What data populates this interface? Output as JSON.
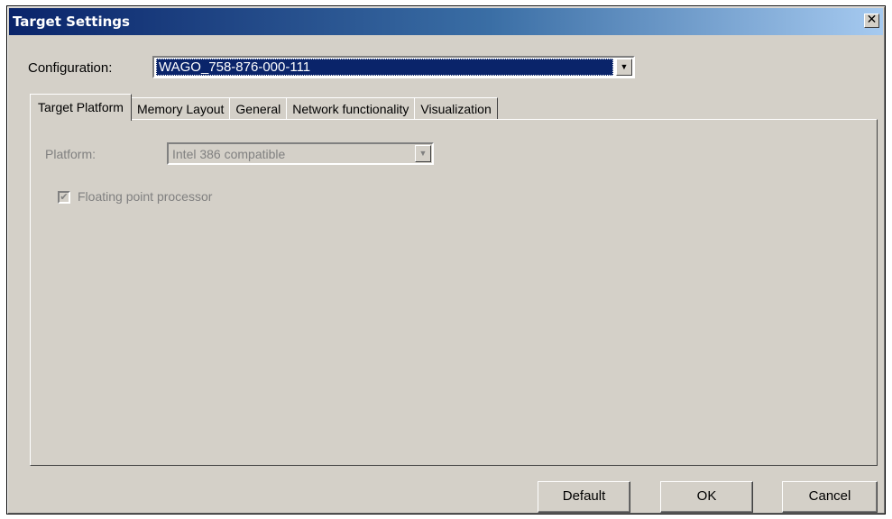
{
  "window": {
    "title": "Target Settings",
    "close_label": "X"
  },
  "configuration": {
    "label": "Configuration:",
    "value": "WAGO_758-876-000-111"
  },
  "tabs": [
    {
      "label": "Target Platform",
      "active": true
    },
    {
      "label": "Memory Layout",
      "active": false
    },
    {
      "label": "General",
      "active": false
    },
    {
      "label": "Network functionality",
      "active": false
    },
    {
      "label": "Visualization",
      "active": false
    }
  ],
  "target_platform": {
    "platform_label": "Platform:",
    "platform_value": "Intel 386 compatible",
    "floating_point_label": "Floating point processor",
    "floating_point_checked": true,
    "enabled": false
  },
  "buttons": {
    "default": "Default",
    "ok": "OK",
    "cancel": "Cancel"
  },
  "icons": {
    "dropdown": "chevron-down-icon",
    "close": "close-icon",
    "checkmark": "checkmark-icon"
  },
  "colors": {
    "dialog_bg": "#d4d0c8",
    "title_start": "#0a246a",
    "title_end": "#a6caf0",
    "selection": "#0a246a",
    "disabled_text": "#808080"
  }
}
